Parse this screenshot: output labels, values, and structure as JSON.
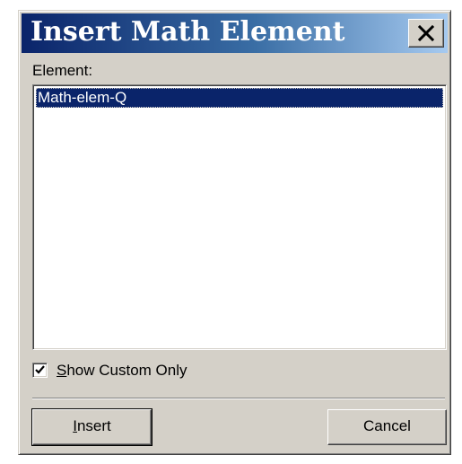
{
  "dialog": {
    "title": "Insert Math Element",
    "close_icon": "close-x-icon"
  },
  "element_label": "Element:",
  "list": {
    "items": [
      "Math-elem-Q"
    ],
    "selected_index": 0
  },
  "show_custom_only": {
    "label_mnemonic": "S",
    "label_rest": "how Custom Only",
    "checked": true,
    "icon": "checkmark-icon"
  },
  "buttons": {
    "insert_mnemonic": "I",
    "insert_rest": "nsert",
    "cancel": "Cancel"
  },
  "colors": {
    "titlebar": "#0a246a",
    "selection": "#0a246a",
    "face": "#d4d0c8"
  }
}
